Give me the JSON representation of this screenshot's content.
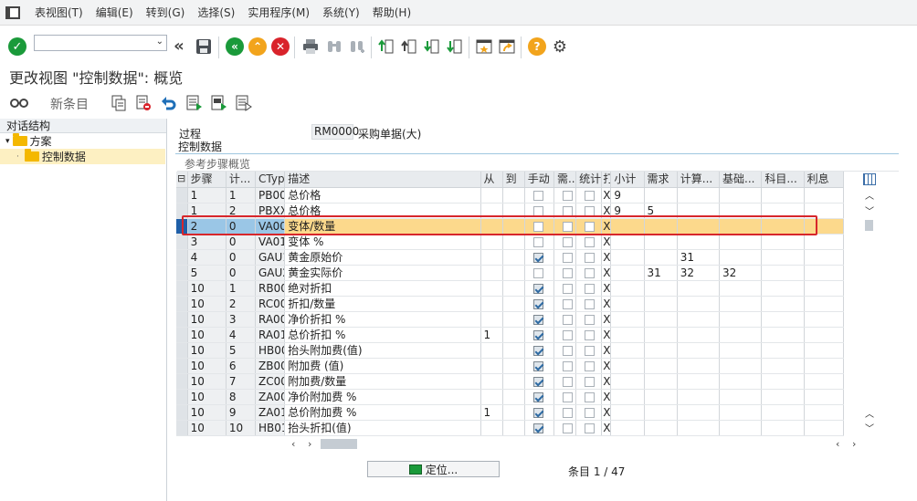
{
  "menu": [
    "表视图(T)",
    "编辑(E)",
    "转到(G)",
    "选择(S)",
    "实用程序(M)",
    "系统(Y)",
    "帮助(H)"
  ],
  "command_field": {
    "value": "",
    "placeholder": ""
  },
  "title": "更改视图 \"控制数据\": 概览",
  "toolbar2": {
    "new_entries": "新条目"
  },
  "left_panel": {
    "header": "对话结构",
    "tree": [
      {
        "label": "方案",
        "level": 0
      },
      {
        "label": "控制数据",
        "level": 1
      }
    ]
  },
  "fields": {
    "process_label": "过程",
    "process_value": "RM0000",
    "process_desc": "采购单据(大)"
  },
  "group_title": "控制数据",
  "subsection": "参考步骤概览",
  "table": {
    "columns": [
      "步骤",
      "计...",
      "CTyp",
      "描述",
      "从",
      "到",
      "手动",
      "需...",
      "统计",
      "打",
      "小计",
      "需求",
      "计算...",
      "基础...",
      "科目...",
      "利息"
    ],
    "rows": [
      {
        "step": "1",
        "counter": "1",
        "ctyp": "PB00",
        "desc": "总价格",
        "from": "",
        "to": "",
        "manual": false,
        "required": false,
        "stat": false,
        "print": "X",
        "subtotal": "9",
        "req": "",
        "calc": "",
        "base": "",
        "acct": "",
        "accrual": ""
      },
      {
        "step": "1",
        "counter": "2",
        "ctyp": "PBXX",
        "desc": "总价格",
        "from": "",
        "to": "",
        "manual": false,
        "required": false,
        "stat": false,
        "print": "X",
        "subtotal": "9",
        "req": "5",
        "calc": "",
        "base": "",
        "acct": "",
        "accrual": ""
      },
      {
        "step": "2",
        "counter": "0",
        "ctyp": "VA00",
        "desc": "变体/数量",
        "from": "",
        "to": "",
        "manual": false,
        "required": false,
        "stat": false,
        "print": "X",
        "subtotal": "",
        "req": "",
        "calc": "",
        "base": "",
        "acct": "",
        "accrual": ""
      },
      {
        "step": "3",
        "counter": "0",
        "ctyp": "VA01",
        "desc": "变体 %",
        "from": "",
        "to": "",
        "manual": false,
        "required": false,
        "stat": false,
        "print": "X",
        "subtotal": "",
        "req": "",
        "calc": "",
        "base": "",
        "acct": "",
        "accrual": ""
      },
      {
        "step": "4",
        "counter": "0",
        "ctyp": "GAU1",
        "desc": "黄金原始价",
        "from": "",
        "to": "",
        "manual": true,
        "required": false,
        "stat": false,
        "print": "X",
        "subtotal": "",
        "req": "",
        "calc": "31",
        "base": "",
        "acct": "",
        "accrual": ""
      },
      {
        "step": "5",
        "counter": "0",
        "ctyp": "GAU2",
        "desc": "黄金实际价",
        "from": "",
        "to": "",
        "manual": false,
        "required": false,
        "stat": false,
        "print": "X",
        "subtotal": "",
        "req": "31",
        "calc": "32",
        "base": "32",
        "acct": "",
        "accrual": ""
      },
      {
        "step": "10",
        "counter": "1",
        "ctyp": "RB00",
        "desc": "绝对折扣",
        "from": "",
        "to": "",
        "manual": true,
        "required": false,
        "stat": false,
        "print": "X",
        "subtotal": "",
        "req": "",
        "calc": "",
        "base": "",
        "acct": "",
        "accrual": ""
      },
      {
        "step": "10",
        "counter": "2",
        "ctyp": "RC00",
        "desc": "折扣/数量",
        "from": "",
        "to": "",
        "manual": true,
        "required": false,
        "stat": false,
        "print": "X",
        "subtotal": "",
        "req": "",
        "calc": "",
        "base": "",
        "acct": "",
        "accrual": ""
      },
      {
        "step": "10",
        "counter": "3",
        "ctyp": "RA00",
        "desc": "净价折扣 %",
        "from": "",
        "to": "",
        "manual": true,
        "required": false,
        "stat": false,
        "print": "X",
        "subtotal": "",
        "req": "",
        "calc": "",
        "base": "",
        "acct": "",
        "accrual": ""
      },
      {
        "step": "10",
        "counter": "4",
        "ctyp": "RA01",
        "desc": "总价折扣 %",
        "from": "1",
        "to": "",
        "manual": true,
        "required": false,
        "stat": false,
        "print": "X",
        "subtotal": "",
        "req": "",
        "calc": "",
        "base": "",
        "acct": "",
        "accrual": ""
      },
      {
        "step": "10",
        "counter": "5",
        "ctyp": "HB00",
        "desc": "抬头附加费(值)",
        "from": "",
        "to": "",
        "manual": true,
        "required": false,
        "stat": false,
        "print": "X",
        "subtotal": "",
        "req": "",
        "calc": "",
        "base": "",
        "acct": "",
        "accrual": ""
      },
      {
        "step": "10",
        "counter": "6",
        "ctyp": "ZB00",
        "desc": "附加费 (值)",
        "from": "",
        "to": "",
        "manual": true,
        "required": false,
        "stat": false,
        "print": "X",
        "subtotal": "",
        "req": "",
        "calc": "",
        "base": "",
        "acct": "",
        "accrual": ""
      },
      {
        "step": "10",
        "counter": "7",
        "ctyp": "ZC00",
        "desc": "附加费/数量",
        "from": "",
        "to": "",
        "manual": true,
        "required": false,
        "stat": false,
        "print": "X",
        "subtotal": "",
        "req": "",
        "calc": "",
        "base": "",
        "acct": "",
        "accrual": ""
      },
      {
        "step": "10",
        "counter": "8",
        "ctyp": "ZA00",
        "desc": "净价附加费 %",
        "from": "",
        "to": "",
        "manual": true,
        "required": false,
        "stat": false,
        "print": "X",
        "subtotal": "",
        "req": "",
        "calc": "",
        "base": "",
        "acct": "",
        "accrual": ""
      },
      {
        "step": "10",
        "counter": "9",
        "ctyp": "ZA01",
        "desc": "总价附加费 %",
        "from": "1",
        "to": "",
        "manual": true,
        "required": false,
        "stat": false,
        "print": "X",
        "subtotal": "",
        "req": "",
        "calc": "",
        "base": "",
        "acct": "",
        "accrual": ""
      },
      {
        "step": "10",
        "counter": "10",
        "ctyp": "HB01",
        "desc": "抬头折扣(值)",
        "from": "",
        "to": "",
        "manual": true,
        "required": false,
        "stat": false,
        "print": "X",
        "subtotal": "",
        "req": "",
        "calc": "",
        "base": "",
        "acct": "",
        "accrual": ""
      }
    ],
    "highlight_row": 2
  },
  "footer": {
    "locate_button": "定位...",
    "entry_label": "条目",
    "entry_count": "1 / 47"
  },
  "colors": {
    "accent": "#1f5fa8",
    "highlight": "#fcd98c",
    "annotation": "#d7262b",
    "ok": "#1a9a3a",
    "cancel": "#d9232b",
    "nav": "#f2a41c",
    "nav_green": "#1a9a3a"
  }
}
